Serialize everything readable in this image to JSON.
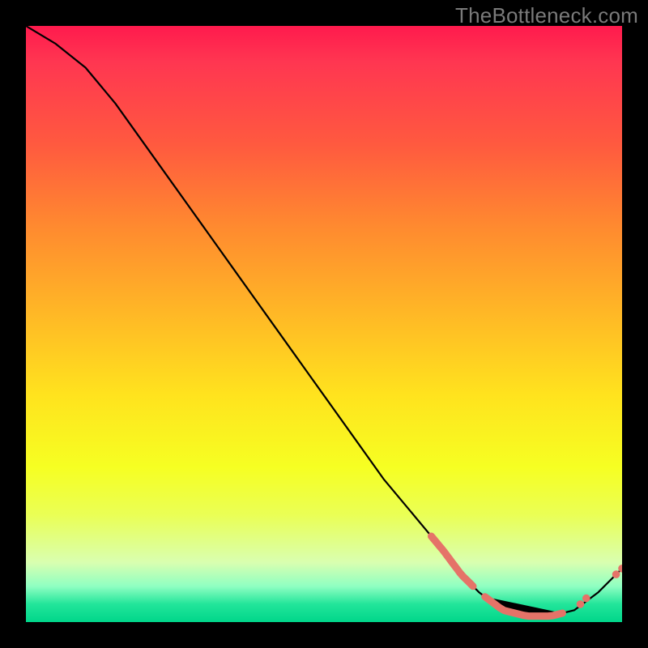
{
  "watermark": "TheBottleneck.com",
  "colors": {
    "background": "#000000",
    "watermark_text": "#7a7a7a",
    "curve": "#000000",
    "marker": "#e57368",
    "gradient_top": "#ff1a4d",
    "gradient_bottom": "#00d68a"
  },
  "chart_data": {
    "type": "line",
    "title": "",
    "xlabel": "",
    "ylabel": "",
    "xlim": [
      0,
      100
    ],
    "ylim": [
      0,
      100
    ],
    "grid": false,
    "legend": false,
    "series": [
      {
        "name": "curve",
        "x": [
          0,
          5,
          10,
          15,
          20,
          25,
          30,
          35,
          40,
          45,
          50,
          55,
          60,
          65,
          70,
          73,
          76,
          80,
          84,
          88,
          92,
          96,
          100
        ],
        "y": [
          100,
          97,
          93,
          87,
          80,
          73,
          66,
          59,
          52,
          45,
          38,
          31,
          24,
          18,
          12,
          8,
          5,
          2,
          1,
          1,
          2,
          5,
          9
        ]
      }
    ],
    "highlighted_segments": [
      {
        "x_start": 68,
        "x_end": 75,
        "note": "thick pink segment on descending slope"
      },
      {
        "x_start": 77,
        "x_end": 90,
        "note": "thick pink segment along trough"
      }
    ],
    "highlighted_points": [
      {
        "x": 93,
        "y": 3
      },
      {
        "x": 94,
        "y": 4
      },
      {
        "x": 99,
        "y": 8
      },
      {
        "x": 100,
        "y": 9
      }
    ]
  }
}
